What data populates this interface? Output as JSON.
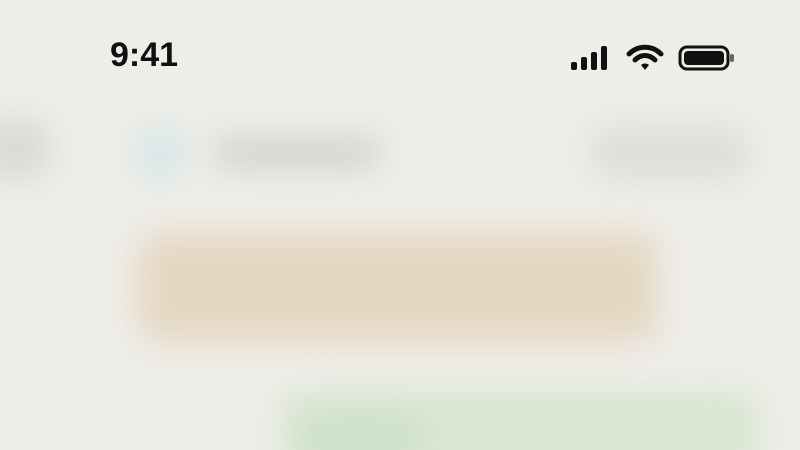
{
  "status_bar": {
    "time": "9:41",
    "signal_icon": "cellular-signal-icon",
    "wifi_icon": "wifi-icon",
    "battery_icon": "battery-icon"
  },
  "colors": {
    "background": "#efede8",
    "card": "#e6dccb",
    "green_card": "#d9e6d2",
    "avatar": "#d8e8e7"
  }
}
